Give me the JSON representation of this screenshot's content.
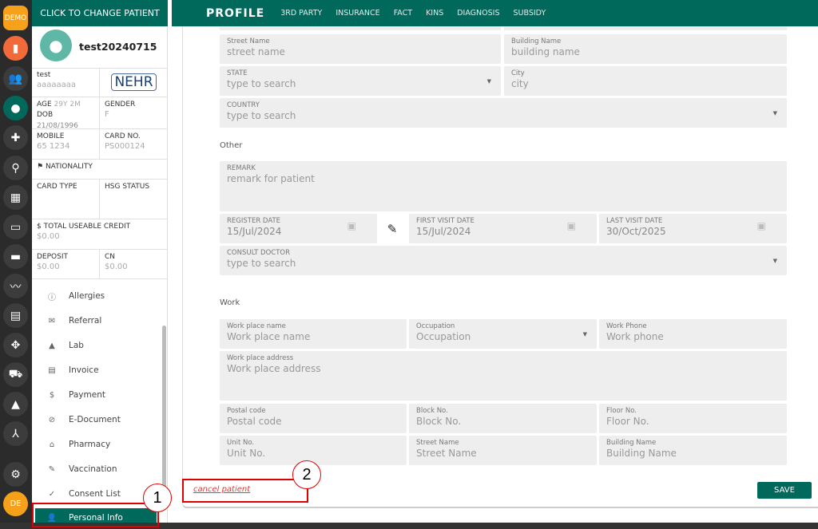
{
  "rail": {
    "demo": "DEMO",
    "user": "DE",
    "colors": {
      "demo": "#f7a11a",
      "map": "#f26a3a",
      "active": "#00695c",
      "user": "#f7a11a"
    }
  },
  "patient": {
    "header": "CLICK TO CHANGE PATIENT",
    "name": "test20240715",
    "short_name": "test",
    "alias": "aaaaaaaa",
    "nehr": "NEHR",
    "age_label": "AGE",
    "age": "29Y 2M",
    "dob_label": "DOB",
    "dob": "21/08/1996",
    "gender_label": "GENDER",
    "gender": "F",
    "mobile_label": "MOBILE",
    "mobile": "65 1234",
    "card_label": "CARD NO.",
    "card": "PS000124",
    "nationality_label": "NATIONALITY",
    "card_type_label": "CARD TYPE",
    "hsg_label": "HSG STATUS",
    "credit_label": "$ TOTAL USEABLE CREDIT",
    "credit": "$0.00",
    "deposit_label": "DEPOSIT",
    "deposit": "$0.00",
    "cn_label": "CN",
    "cn": "$0.00"
  },
  "menu": [
    {
      "icon": "ⓘ",
      "label": "Allergies"
    },
    {
      "icon": "✉",
      "label": "Referral"
    },
    {
      "icon": "▲",
      "label": "Lab"
    },
    {
      "icon": "▤",
      "label": "Invoice"
    },
    {
      "icon": "$",
      "label": "Payment"
    },
    {
      "icon": "⊘",
      "label": "E-Document"
    },
    {
      "icon": "⌂",
      "label": "Pharmacy"
    },
    {
      "icon": "✎",
      "label": "Vaccination"
    },
    {
      "icon": "✓",
      "label": "Consent List"
    },
    {
      "icon": "👤",
      "label": "Personal Info"
    }
  ],
  "tabs": {
    "title": "PROFILE",
    "items": [
      "3RD PARTY",
      "INSURANCE",
      "FACT",
      "KINS",
      "DIAGNOSIS",
      "SUBSIDY"
    ]
  },
  "form": {
    "street": {
      "label": "Street Name",
      "ph": "street name"
    },
    "building": {
      "label": "Building Name",
      "ph": "building name"
    },
    "state": {
      "label": "STATE",
      "ph": "type to search"
    },
    "city": {
      "label": "City",
      "ph": "city"
    },
    "country": {
      "label": "COUNTRY",
      "ph": "type to search"
    },
    "other": "Other",
    "remark": {
      "label": "REMARK",
      "ph": "remark for patient"
    },
    "register": {
      "label": "REGISTER DATE",
      "value": "15/Jul/2024"
    },
    "first": {
      "label": "FIRST VISIT DATE",
      "value": "15/Jul/2024"
    },
    "last": {
      "label": "LAST VISIT DATE",
      "value": "30/Oct/2025"
    },
    "doctor": {
      "label": "CONSULT DOCTOR",
      "ph": "type to search"
    },
    "work": "Work",
    "wp_name": {
      "label": "Work place name",
      "ph": "Work place name"
    },
    "occupation": {
      "label": "Occupation",
      "ph": "Occupation"
    },
    "wphone": {
      "label": "Work Phone",
      "ph": "Work phone"
    },
    "wp_addr": {
      "label": "Work place address",
      "ph": "Work place address"
    },
    "postal": {
      "label": "Postal code",
      "ph": "Postal code"
    },
    "block": {
      "label": "Block No.",
      "ph": "Block No."
    },
    "floor": {
      "label": "Floor No.",
      "ph": "Floor No."
    },
    "unit": {
      "label": "Unit No.",
      "ph": "Unit No."
    },
    "wstreet": {
      "label": "Street Name",
      "ph": "Street Name"
    },
    "wbuilding": {
      "label": "Building Name",
      "ph": "Building Name"
    }
  },
  "footer": {
    "cancel": "cancel patient",
    "save": "SAVE"
  },
  "annotations": [
    "1",
    "2"
  ]
}
